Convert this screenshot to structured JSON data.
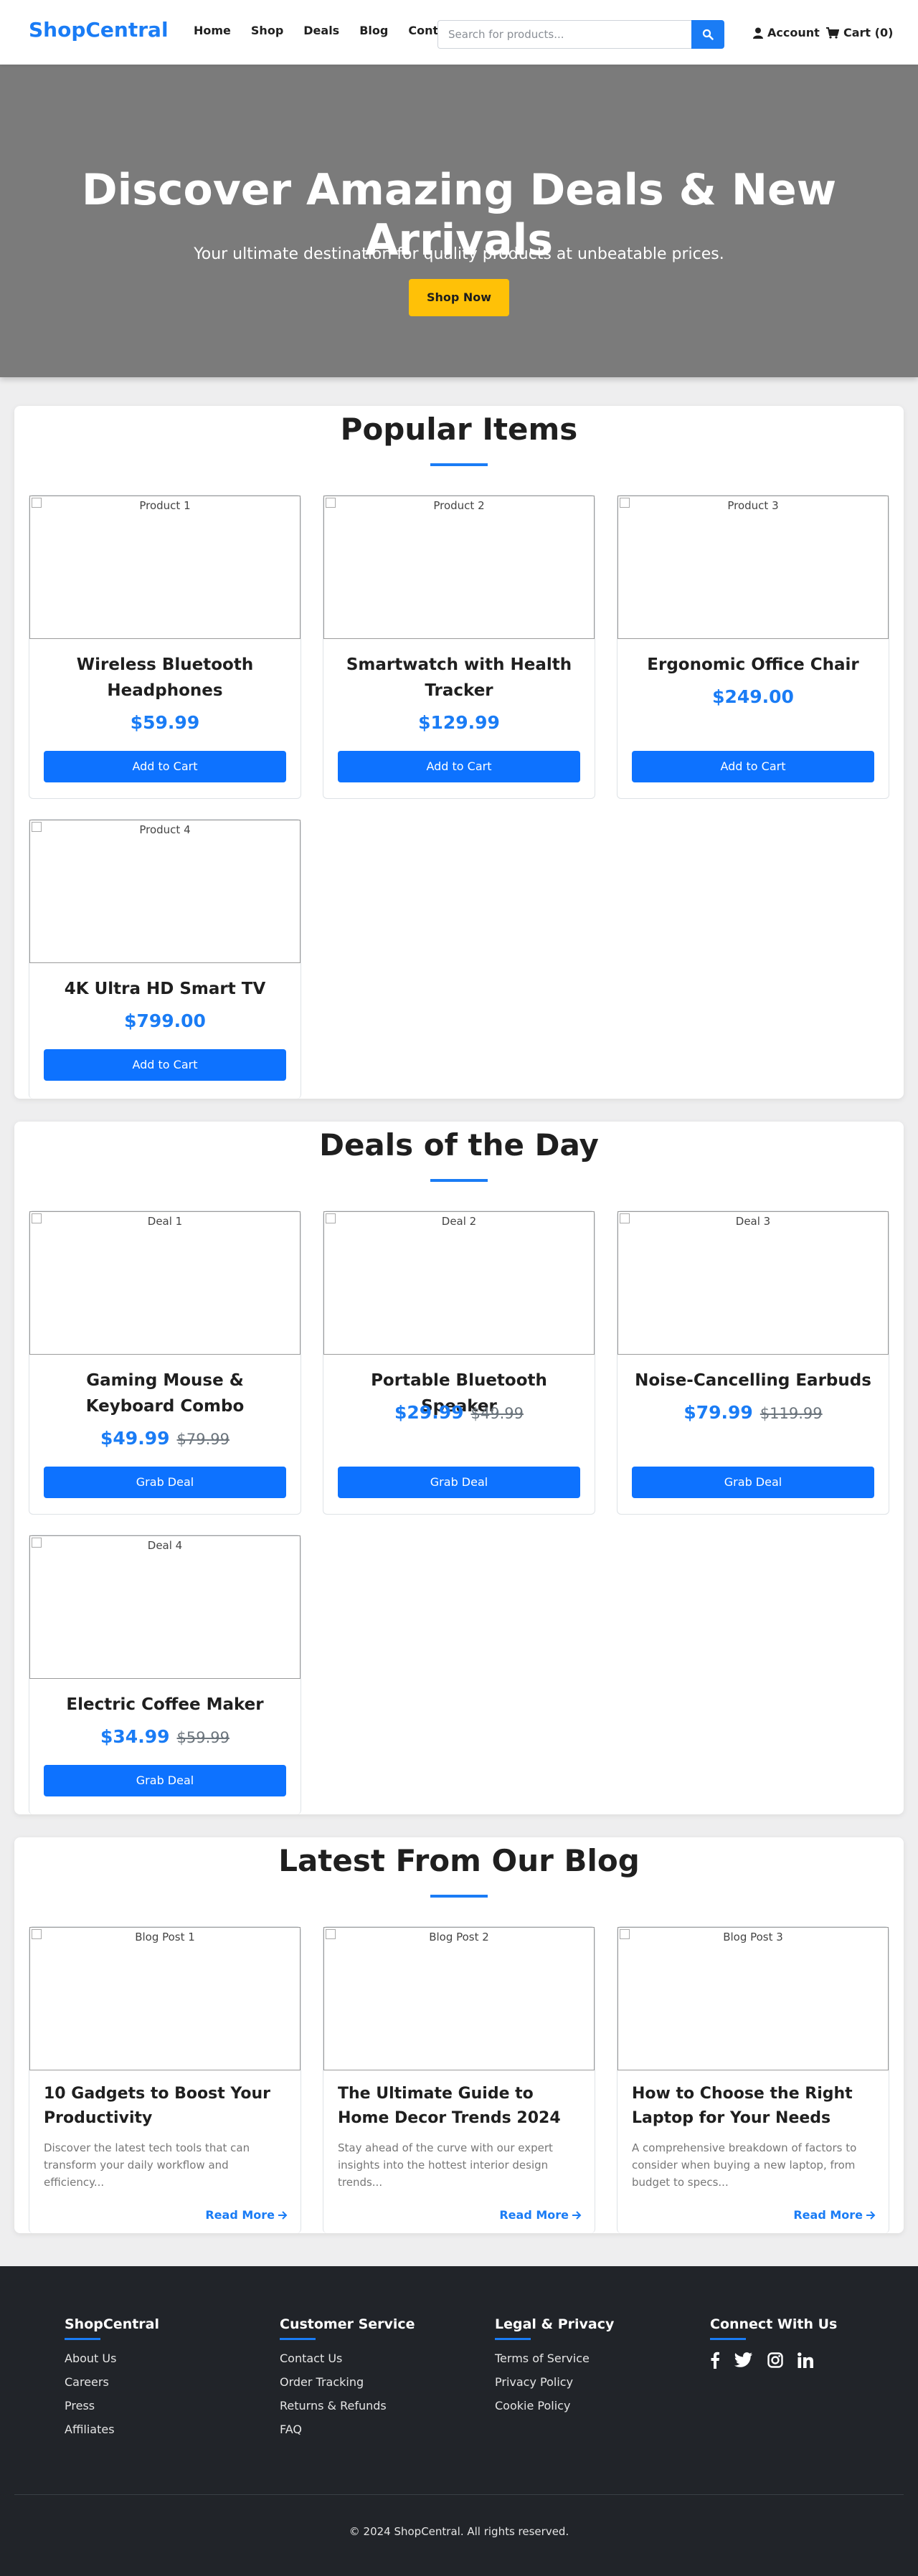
{
  "header": {
    "logo": "ShopCentral",
    "nav": [
      "Home",
      "Shop",
      "Deals",
      "Blog",
      "Contact"
    ],
    "search_placeholder": "Search for products...",
    "account_label": "Account",
    "cart_label": "Cart (0)"
  },
  "hero": {
    "title": "Discover Amazing Deals & New Arrivals",
    "subtitle": "Your ultimate destination for quality products at unbeatable prices.",
    "cta": "Shop Now"
  },
  "popular": {
    "title": "Popular Items",
    "button_label": "Add to Cart",
    "items": [
      {
        "image_alt": "Product 1",
        "name": "Wireless Bluetooth Headphones",
        "price": "$59.99"
      },
      {
        "image_alt": "Product 2",
        "name": "Smartwatch with Health Tracker",
        "price": "$129.99"
      },
      {
        "image_alt": "Product 3",
        "name": "Ergonomic Office Chair",
        "price": "$249.00"
      },
      {
        "image_alt": "Product 4",
        "name": "4K Ultra HD Smart TV",
        "price": "$799.00"
      }
    ]
  },
  "deals": {
    "title": "Deals of the Day",
    "button_label": "Grab Deal",
    "items": [
      {
        "image_alt": "Deal 1",
        "name": "Gaming Mouse & Keyboard Combo",
        "price": "$49.99",
        "old_price": "$79.99"
      },
      {
        "image_alt": "Deal 2",
        "name": "Portable Bluetooth Speaker",
        "price": "$29.99",
        "old_price": "$49.99"
      },
      {
        "image_alt": "Deal 3",
        "name": "Noise-Cancelling Earbuds",
        "price": "$79.99",
        "old_price": "$119.99"
      },
      {
        "image_alt": "Deal 4",
        "name": "Electric Coffee Maker",
        "price": "$34.99",
        "old_price": "$59.99"
      }
    ]
  },
  "blog": {
    "title": "Latest From Our Blog",
    "read_more": "Read More",
    "posts": [
      {
        "image_alt": "Blog Post 1",
        "title": "10 Gadgets to Boost Your Productivity",
        "excerpt": "Discover the latest tech tools that can transform your daily workflow and efficiency..."
      },
      {
        "image_alt": "Blog Post 2",
        "title": "The Ultimate Guide to Home Decor Trends 2024",
        "excerpt": "Stay ahead of the curve with our expert insights into the hottest interior design trends..."
      },
      {
        "image_alt": "Blog Post 3",
        "title": "How to Choose the Right Laptop for Your Needs",
        "excerpt": "A comprehensive breakdown of factors to consider when buying a new laptop, from budget to specs..."
      }
    ]
  },
  "footer": {
    "columns": [
      {
        "heading": "ShopCentral",
        "links": [
          "About Us",
          "Careers",
          "Press",
          "Affiliates"
        ]
      },
      {
        "heading": "Customer Service",
        "links": [
          "Contact Us",
          "Order Tracking",
          "Returns & Refunds",
          "FAQ"
        ]
      },
      {
        "heading": "Legal & Privacy",
        "links": [
          "Terms of Service",
          "Privacy Policy",
          "Cookie Policy"
        ]
      },
      {
        "heading": "Connect With Us",
        "social": [
          "facebook-icon",
          "twitter-icon",
          "instagram-icon",
          "linkedin-icon"
        ]
      }
    ],
    "copyright": "© 2024 ShopCentral. All rights reserved."
  },
  "colors": {
    "accent": "#1a7cf5",
    "button": "#0d72ff",
    "cta": "#ffc107",
    "hero_bg": "#7b7b7b",
    "footer_bg": "#212429"
  }
}
